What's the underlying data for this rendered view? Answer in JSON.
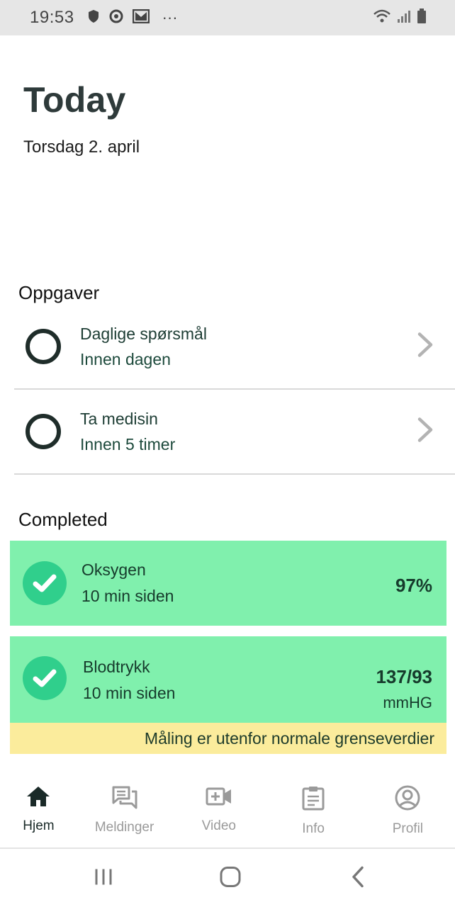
{
  "status_bar": {
    "time": "19:53",
    "left_icons": [
      "shield-icon",
      "vpn-icon",
      "gmail-icon",
      "more-icon"
    ],
    "right_icons": [
      "wifi-icon",
      "signal-icon",
      "battery-icon"
    ]
  },
  "header": {
    "title": "Today",
    "date": "Torsdag 2. april"
  },
  "tasks": {
    "title": "Oppgaver",
    "items": [
      {
        "title": "Daglige spørsmål",
        "subtitle": "Innen dagen"
      },
      {
        "title": "Ta medisin",
        "subtitle": "Innen 5 timer"
      }
    ]
  },
  "completed": {
    "title": "Completed",
    "items": [
      {
        "title": "Oksygen",
        "subtitle": "10 min siden",
        "value": "97%",
        "unit": ""
      },
      {
        "title": "Blodtrykk",
        "subtitle": "10 min siden",
        "value": "137/93",
        "unit": "mmHG",
        "warning": "Måling er utenfor normale grenseverdier"
      }
    ]
  },
  "colors": {
    "completed_bg": "#80f0ad",
    "check_bg": "#30cf8c",
    "warning_bg": "#fbec9c"
  },
  "tabbar": {
    "items": [
      {
        "label": "Hjem",
        "icon": "home-icon",
        "active": true
      },
      {
        "label": "Meldinger",
        "icon": "messages-icon",
        "active": false
      },
      {
        "label": "Video",
        "icon": "video-icon",
        "active": false
      },
      {
        "label": "Info",
        "icon": "clipboard-icon",
        "active": false
      },
      {
        "label": "Profil",
        "icon": "profile-icon",
        "active": false
      }
    ]
  },
  "system_nav": [
    "recent-apps-icon",
    "home-button-icon",
    "back-icon"
  ]
}
